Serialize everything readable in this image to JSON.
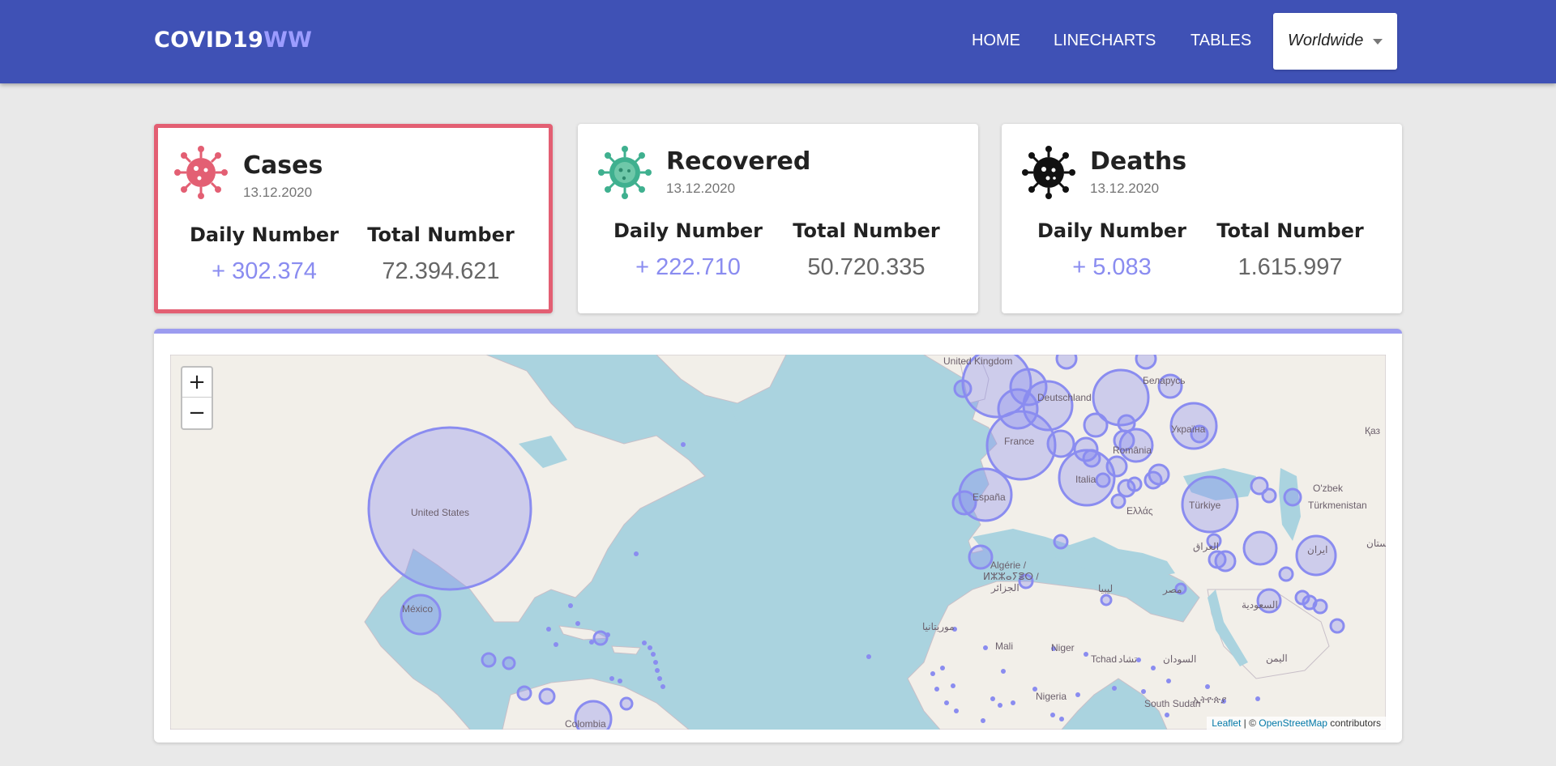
{
  "brand": {
    "main": "COVID19",
    "accent": "WW"
  },
  "nav": {
    "home": "HOME",
    "linecharts": "LINECHARTS",
    "tables": "TABLES"
  },
  "region_select": {
    "value": "Worldwide"
  },
  "cards": {
    "cases": {
      "title": "Cases",
      "date": "13.12.2020",
      "daily_label": "Daily Number",
      "daily_value": "+ 302.374",
      "total_label": "Total Number",
      "total_value": "72.394.621",
      "icon": "virus-icon",
      "icon_color": "#e35f73"
    },
    "recovered": {
      "title": "Recovered",
      "date": "13.12.2020",
      "daily_label": "Daily Number",
      "daily_value": "+ 222.710",
      "total_label": "Total Number",
      "total_value": "50.720.335",
      "icon": "virus-icon",
      "icon_color": "#3fb08f"
    },
    "deaths": {
      "title": "Deaths",
      "date": "13.12.2020",
      "daily_label": "Daily Number",
      "daily_value": "+ 5.083",
      "total_label": "Total Number",
      "total_value": "1.615.997",
      "icon": "virus-icon",
      "icon_color": "#111111"
    }
  },
  "map": {
    "zoom_in": "+",
    "zoom_out": "−",
    "attribution": {
      "leaflet": "Leaflet",
      "separator": " | © ",
      "osm": "OpenStreetMap",
      "suffix": " contributors"
    },
    "labels": {
      "us": "United States",
      "mexico": "México",
      "uk": "United Kingdom",
      "france": "France",
      "germany": "Deutschland",
      "espana": "España",
      "italia": "Italia",
      "ukraine": "Україна",
      "turkiye": "Türkiye",
      "romania": "România",
      "belarus": "Беларусь",
      "algeria": "Algérie /",
      "algeria2": "ⵍⵣⵣⴰⵢⴻⵔ /",
      "algeria3": "الجزائر",
      "libya": "ليبيا",
      "egypt": "مصر",
      "mali": "Mali",
      "niger": "Niger",
      "tchad": "Tchad",
      "tchad_ar": "تشاد",
      "sudan": "السودان",
      "nigeria": "Nigeria",
      "south_sudan": "South Sudan",
      "iraq": "العراق",
      "iran": "ایران",
      "saudi": "السعودية",
      "yemen": "اليمن",
      "turkmenistan": "Türkmenistan",
      "uzbek": "O'zbek",
      "kazakh": "Қаз",
      "hellas": "Ελλάς",
      "mauritania": "موريتانيا",
      "colombia": "Colombia",
      "ethiopia": "ኢትዮጵያ",
      "afghan": "افغانستان"
    },
    "bubble_color": "#8a8cf0"
  }
}
